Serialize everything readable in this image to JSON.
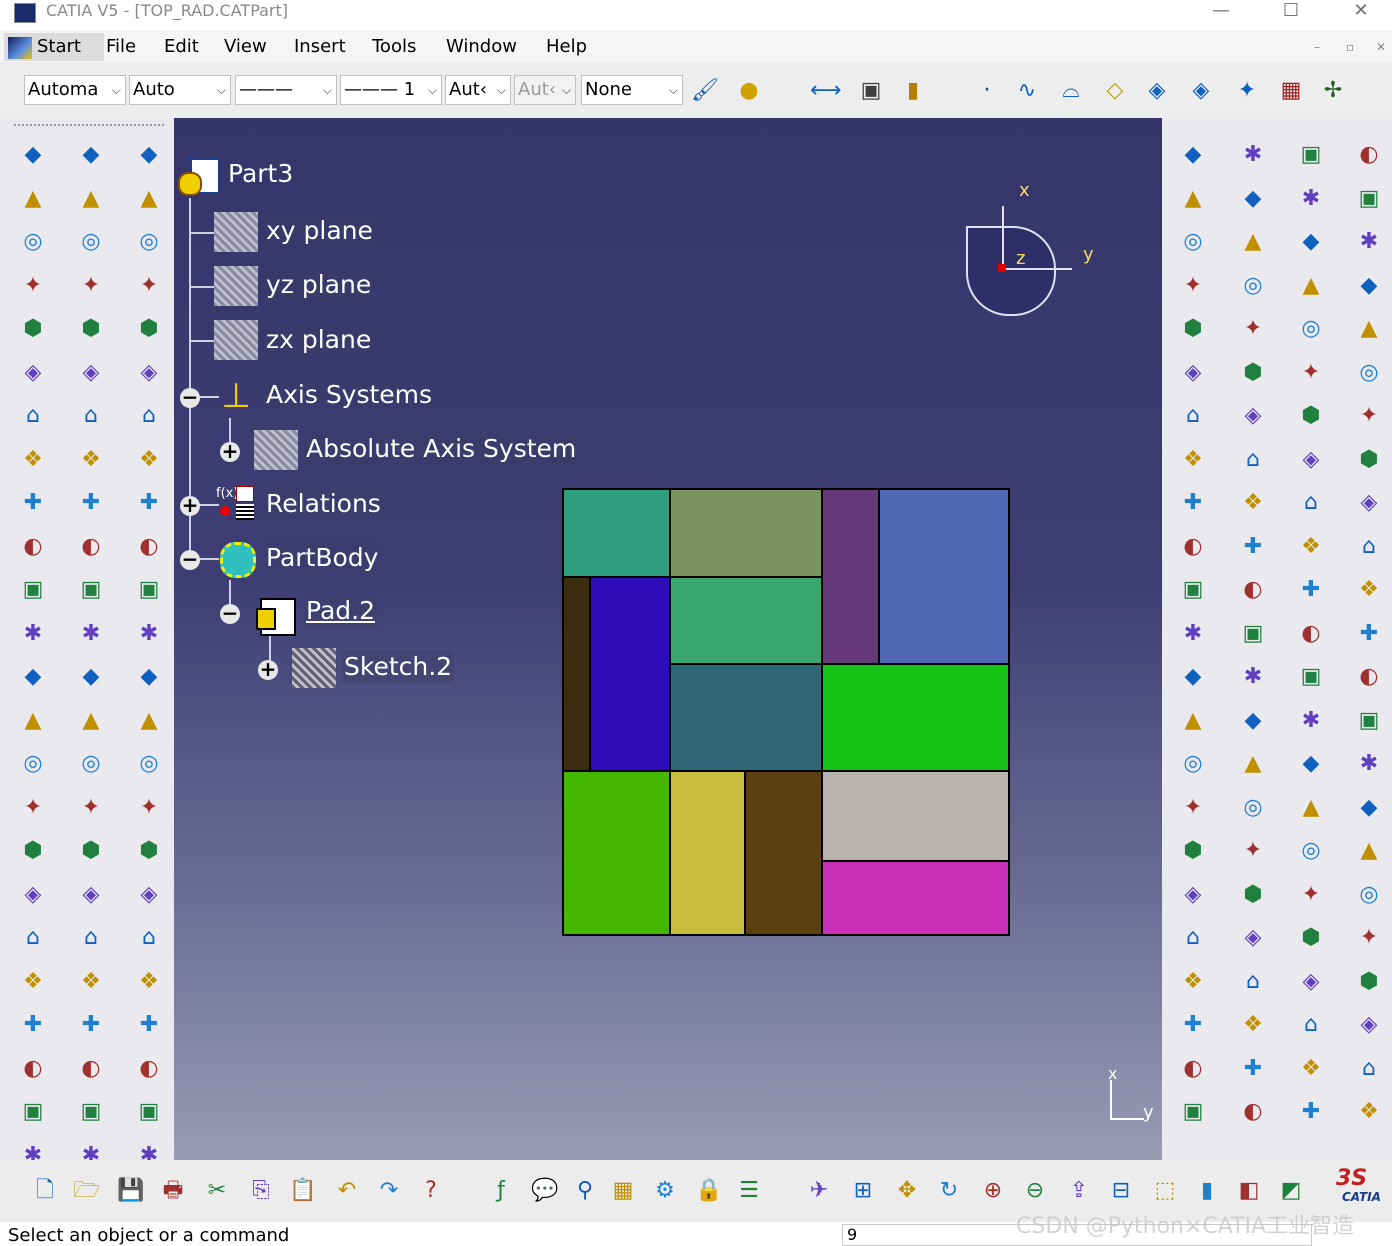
{
  "window": {
    "title": "CATIA V5 - [TOP_RAD.CATPart]",
    "minimize": "—",
    "maximize": "☐",
    "close": "✕"
  },
  "menu": {
    "items": [
      "Start",
      "File",
      "Edit",
      "View",
      "Insert",
      "Tools",
      "Window",
      "Help"
    ]
  },
  "toolbar_top": {
    "combos": [
      {
        "value": "Automa",
        "disabled": false
      },
      {
        "value": "Auto",
        "disabled": false
      },
      {
        "value": "———",
        "disabled": false
      },
      {
        "value": "——— 1",
        "disabled": false
      },
      {
        "value": "Aut‹",
        "disabled": false
      },
      {
        "value": "Aut‹",
        "disabled": true
      },
      {
        "value": "None",
        "disabled": false
      }
    ]
  },
  "tree": {
    "root": "Part3",
    "items": [
      "xy plane",
      "yz plane",
      "zx plane",
      "Axis Systems",
      "Absolute Axis System",
      "Relations",
      "PartBody",
      "Pad.2",
      "Sketch.2"
    ]
  },
  "compass": {
    "x": "x",
    "y": "y",
    "z": "z"
  },
  "axis_corner": {
    "x": "x",
    "y": "y"
  },
  "mosaic_colors": {
    "teal": "#2e9e7e",
    "olive": "#7a9460",
    "purple": "#663a7a",
    "steel": "#5068b4",
    "darkbrown": "#3d2d10",
    "indigo": "#2e0cb8",
    "jade": "#3aa86e",
    "slate": "#2e6876",
    "green": "#14c414",
    "lime": "#44b800",
    "mustard": "#c8bc3c",
    "brown": "#5a4010",
    "gray": "#b8b4b0",
    "magenta": "#c82eb8"
  },
  "status": {
    "message": "Select an object or a command",
    "input": "9"
  },
  "watermark": "CSDN @Python×CATIA工业智造",
  "logo": "CATIA"
}
